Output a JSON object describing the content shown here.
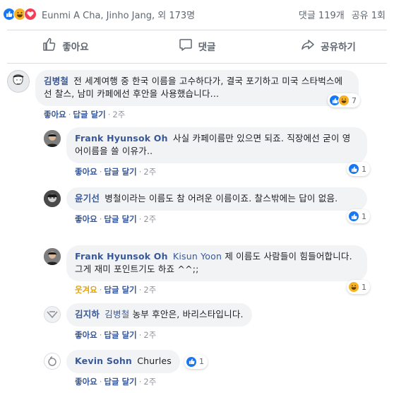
{
  "summary": {
    "names": "Eunmi A Cha, Jinho Jang, 외 173명",
    "comments": "댓글 119개",
    "shares": "공유 1회"
  },
  "actions": {
    "like": "좋아요",
    "comment": "댓글",
    "share": "공유하기"
  },
  "colors": {
    "accent": "#385898",
    "like": "#1877f2",
    "haha": "#f7b125",
    "love": "#f33e58"
  },
  "comments": [
    {
      "author": "김병철",
      "text": "전 세계여행 중 한국 이름을 고수하다가, 결국 포기하고 미국 스타벅스에선 찰스, 남미 카페에선 후안을 사용했습니다...",
      "action": "좋아요",
      "reply": "답글 달기",
      "time": "2주",
      "reaction_count": "7",
      "replies": [
        {
          "author": "Frank Hyunsok Oh",
          "text": "사실 카페이름만 있으면 되죠. 직장에선 굳이 영어이름을 쓸 이유가..",
          "action": "좋아요",
          "reply": "답글 달기",
          "time": "2주",
          "reaction_count": "1"
        },
        {
          "author": "윤기선",
          "text": "병철이라는 이름도 참 어려운 이름이죠. 찰스밖에는 답이 없음.",
          "action": "좋아요",
          "reply": "답글 달기",
          "time": "2주",
          "reaction_count": "1"
        },
        {
          "author": "Frank Hyunsok Oh",
          "mention": "Kisun Yoon",
          "text": "제 이름도 사람들이 힘들어합니다. 그게 재미 포인트기도 하죠 ^^;;",
          "action": "웃겨요",
          "reply": "답글 달기",
          "time": "2주",
          "reaction_count": "1"
        },
        {
          "author": "김지하",
          "mention": "김병철",
          "text": "농부 후안은, 바리스타입니다.",
          "action": "좋아요",
          "reply": "답글 달기",
          "time": "2주"
        },
        {
          "author": "Kevin Sohn",
          "text": "Churles",
          "action": "좋아요",
          "reply": "답글 달기",
          "time": "2주",
          "reaction_count": "1"
        }
      ]
    }
  ]
}
